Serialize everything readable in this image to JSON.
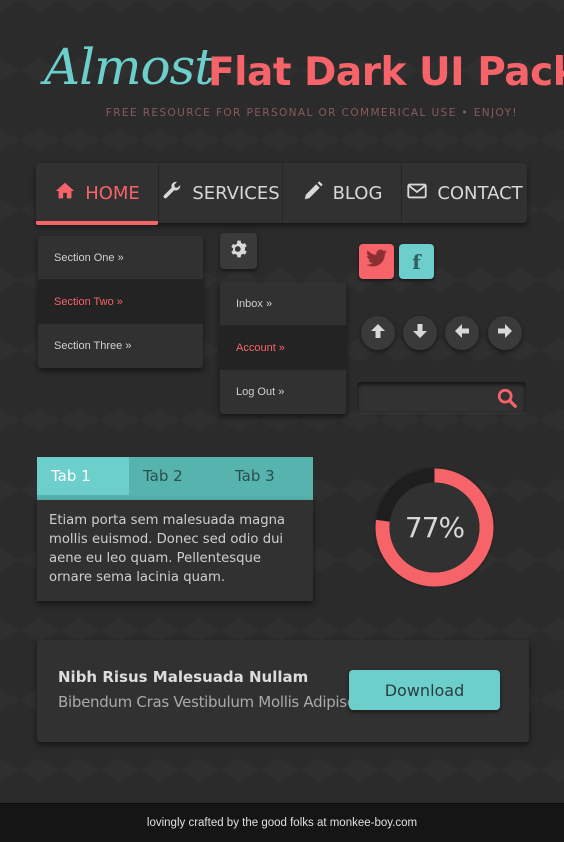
{
  "header": {
    "title_script": "Almost",
    "title_bold": "Flat Dark UI Pack",
    "subtitle": "FREE RESOURCE FOR PERSONAL OR COMMERICAL USE  •  ENJOY!"
  },
  "nav": {
    "items": [
      {
        "label": "HOME",
        "icon": "home-icon",
        "active": true
      },
      {
        "label": "SERVICES",
        "icon": "wrench-icon",
        "active": false
      },
      {
        "label": "BLOG",
        "icon": "pencil-icon",
        "active": false
      },
      {
        "label": "CONTACT",
        "icon": "envelope-icon",
        "active": false
      }
    ]
  },
  "section_menu": {
    "items": [
      {
        "label": "Section One »",
        "active": false
      },
      {
        "label": "Section Two »",
        "active": true
      },
      {
        "label": "Section Three »",
        "active": false
      }
    ]
  },
  "settings_menu": {
    "icon": "gear-icon",
    "items": [
      {
        "label": "Inbox »",
        "active": false
      },
      {
        "label": "Account »",
        "active": true
      },
      {
        "label": "Log Out »",
        "active": false
      }
    ]
  },
  "social": {
    "twitter_icon": "twitter-icon",
    "facebook_label": "f"
  },
  "arrows": [
    "arrow-up-icon",
    "arrow-down-icon",
    "arrow-left-icon",
    "arrow-right-icon"
  ],
  "search": {
    "value": "",
    "icon": "search-icon"
  },
  "tabs": {
    "items": [
      {
        "label": "Tab 1",
        "active": true
      },
      {
        "label": "Tab 2",
        "active": false
      },
      {
        "label": "Tab 3",
        "active": false
      }
    ],
    "content": "Etiam porta sem malesuada magna mollis euismod. Donec sed odio dui aene eu leo quam. Pellentesque ornare sema lacinia quam."
  },
  "progress": {
    "value": 0.77,
    "label": "77%"
  },
  "cta": {
    "title": "Nibh Risus Malesuada Nullam",
    "subtitle": "Bibendum Cras Vestibulum Mollis Adipiscing!",
    "button_label": "Download"
  },
  "footer": {
    "text": "lovingly crafted by the good folks at monkee-boy.com"
  },
  "colors": {
    "accent_red": "#f6646a",
    "accent_teal": "#6ccfcb",
    "background": "#2b2b2c",
    "panel": "#313132"
  }
}
